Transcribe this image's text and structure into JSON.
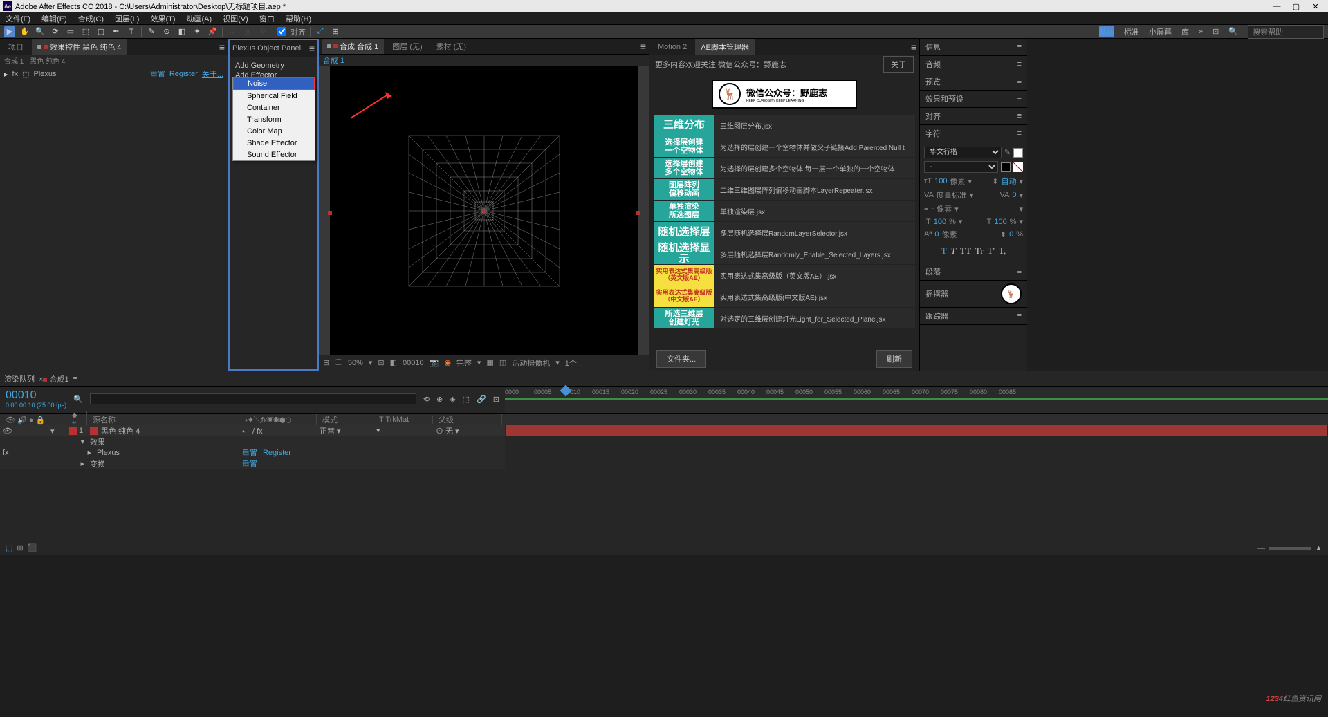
{
  "title": "Adobe After Effects CC 2018 - C:\\Users\\Administrator\\Desktop\\无标题项目.aep *",
  "menus": [
    "文件(F)",
    "编辑(E)",
    "合成(C)",
    "图层(L)",
    "效果(T)",
    "动画(A)",
    "视图(V)",
    "窗口",
    "帮助(H)"
  ],
  "toolbar_align": "对齐",
  "workspaces": [
    "默认",
    "标准",
    "小屏幕",
    "库"
  ],
  "search_placeholder": "搜索帮助",
  "project": {
    "tab1": "项目",
    "tab2": "效果控件 黑色 纯色 4",
    "sub": "合成 1 · 黑色 纯色 4",
    "plexus": "Plexus",
    "switches": "重置",
    "register": "Register",
    "about": "关于..."
  },
  "plexus_panel": {
    "title": "Plexus Object Panel",
    "add_geometry": "Add Geometry",
    "add_effector": "Add Effector"
  },
  "effector_menu": [
    "Noise",
    "Spherical Field",
    "Container",
    "Transform",
    "Color Map",
    "Shade Effector",
    "Sound Effector"
  ],
  "viewer": {
    "tab_comp": "合成 合成 1",
    "tab_layer": "图层 (无)",
    "tab_footage": "素材 (无)",
    "sub": "合成 1",
    "zoom": "50%",
    "frame": "00010",
    "quality": "完整",
    "camera": "活动摄像机",
    "views": "1个..."
  },
  "scripts": {
    "tab_motion": "Motion 2",
    "tab_mgr": "AE脚本管理器",
    "desc": "更多内容欢迎关注 微信公众号：野鹿志",
    "about": "关于",
    "banner_main": "微信公众号：野鹿志",
    "banner_sub": "KEEP CURIOSITY KEEP LEARNING",
    "items": [
      {
        "btn": "三维分布",
        "cls": "teal big",
        "desc": "三维图层分布.jsx"
      },
      {
        "btn": "选择层创建\n一个空物体",
        "cls": "teal",
        "desc": "为选择的层创建一个空物体并做父子链接Add Parented Null t"
      },
      {
        "btn": "选择层创建\n多个空物体",
        "cls": "teal",
        "desc": "为选择的层创建多个空物体 每一层一个单独的一个空物体"
      },
      {
        "btn": "图层阵列\n偏移动画",
        "cls": "teal",
        "desc": "二维三维图层阵列偏移动画脚本LayerRepeater.jsx"
      },
      {
        "btn": "单独渲染\n所选图层",
        "cls": "teal",
        "desc": "单独渲染层.jsx"
      },
      {
        "btn": "随机选择层",
        "cls": "teal big",
        "desc": "多层随机选择层RandomLayerSelector.jsx"
      },
      {
        "btn": "随机选择显示",
        "cls": "teal big",
        "desc": "多层随机选择层Randomly_Enable_Selected_Layers.jsx"
      },
      {
        "btn": "实用表达式集高级版\n（英文版AE）",
        "cls": "yellow",
        "desc": "实用表达式集高级版（英文版AE）.jsx"
      },
      {
        "btn": "实用表达式集高级版\n（中文版AE）",
        "cls": "yellow",
        "desc": "实用表达式集高级版(中文版AE).jsx"
      },
      {
        "btn": "所选三维层\n创建灯光",
        "cls": "teal",
        "desc": "对选定的三维层创建灯光Light_for_Selected_Plane.jsx"
      }
    ],
    "folder": "文件夹...",
    "refresh": "刷新"
  },
  "sidebar": {
    "sections": [
      "信息",
      "音频",
      "预览",
      "效果和预设",
      "对齐",
      "字符"
    ],
    "font": "华文行楷",
    "font_style": "-",
    "size": "100",
    "size_unit": "像素",
    "auto": "自动",
    "va": "度量标准",
    "va_val": "0",
    "unit2": "像素",
    "scale": "100",
    "pct": "%",
    "scale2": "100",
    "shift": "0",
    "shift_unit": "像素",
    "shift2": "0",
    "text_btns": [
      "T",
      "T",
      "TT",
      "Tr",
      "T'",
      "T,"
    ],
    "paragraph": "段落",
    "wiggler": "摇摆器",
    "tracker": "跟踪器"
  },
  "timeline": {
    "tab_render": "渲染队列",
    "tab_comp": "合成1",
    "frame": "00010",
    "timecode": "0:00:00:10 (25.00 fps)",
    "col_src": "源名称",
    "col_mode": "模式",
    "col_trk": "T  TrkMat",
    "col_parent": "父级",
    "layer_num": "1",
    "layer_name": "黑色 纯色 4",
    "layer_mode": "正常",
    "layer_parent": "无",
    "fx": "效果",
    "plexus": "Plexus",
    "plexus_reset": "重置",
    "plexus_reg": "Register",
    "transform": "变换",
    "transform_reset": "重置",
    "ruler": [
      "0000",
      "00005",
      "00010",
      "00015",
      "00020",
      "00025",
      "00030",
      "00035",
      "00040",
      "00045",
      "00050",
      "00055",
      "00060",
      "00065",
      "00070",
      "00075",
      "00080",
      "00085"
    ]
  },
  "watermark_num": "1234",
  "watermark_text": "红鱼资讯网"
}
